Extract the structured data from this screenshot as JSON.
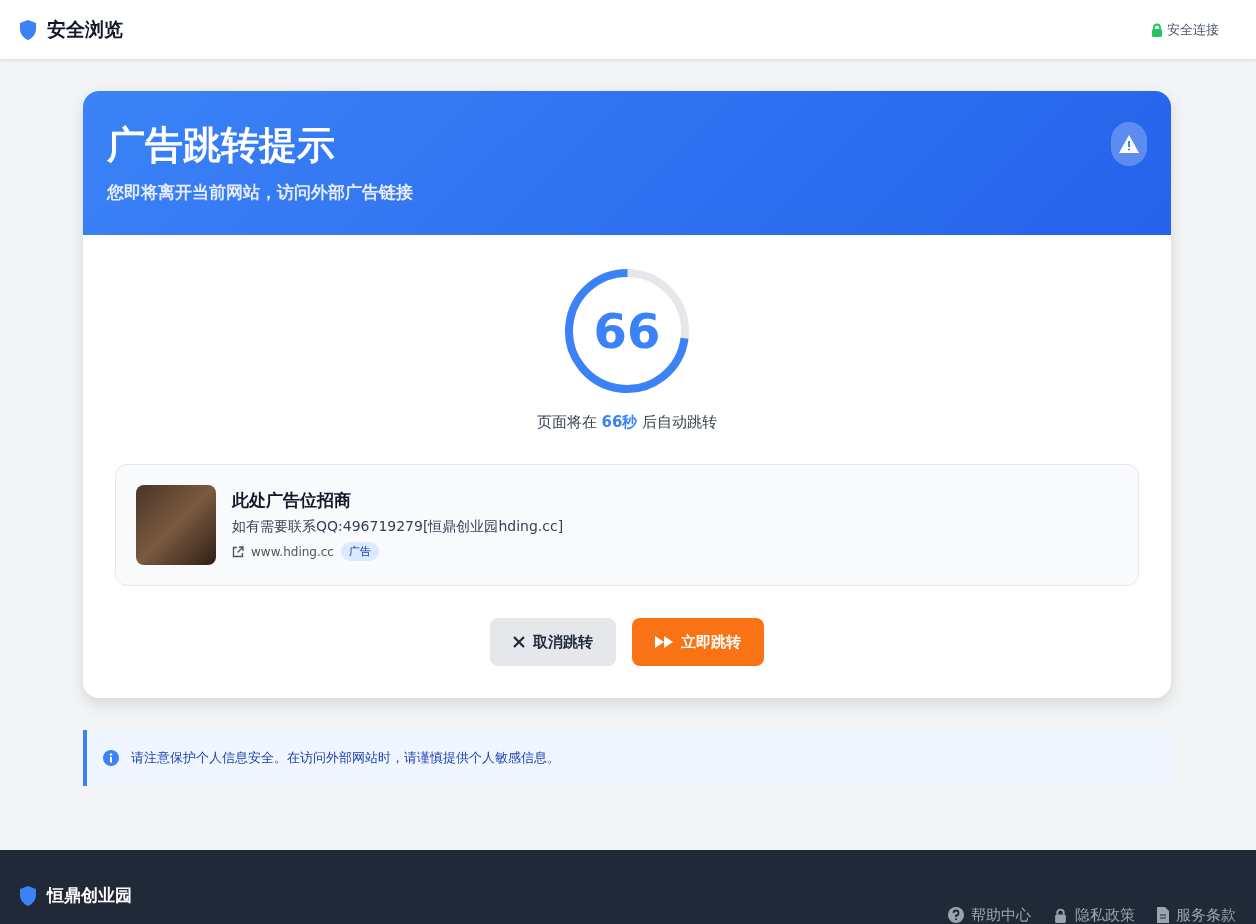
{
  "topbar": {
    "brand": "安全浏览",
    "status": "安全连接"
  },
  "dialog": {
    "title": "广告跳转提示",
    "subtitle": "您即将离开当前网站，访问外部广告链接",
    "countdown": {
      "number": "66",
      "level": 0.73,
      "message": "页面将在 **66秒** 后自动跳转"
    },
    "ad": {
      "title": "此处广告位招商",
      "description": "如有需要联系QQ:496719279[恒鼎创业园hding.cc]",
      "url": "www.hding.cc",
      "tag": "广告"
    },
    "buttons": [
      {
        "kind": "cancel",
        "label": "取消跳转"
      },
      {
        "kind": "go",
        "label": "立即跳转"
      }
    ]
  },
  "notice": "请注意保护个人信息安全。在访问外部网站时，请谨慎提供个人敏感信息。",
  "footer": {
    "brand": "恒鼎创业园",
    "links": [
      {
        "kind": "help",
        "label": "帮助中心"
      },
      {
        "kind": "privacy",
        "label": "隐私政策"
      },
      {
        "kind": "terms",
        "label": "服务条款"
      }
    ]
  }
}
